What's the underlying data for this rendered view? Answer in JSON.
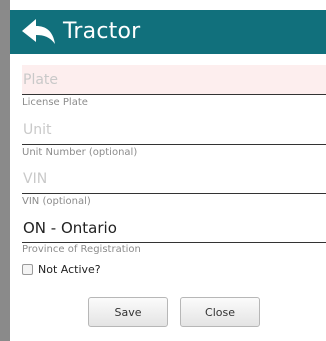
{
  "header": {
    "title": "Tractor",
    "back_icon": "back-arrow-icon",
    "background_color": "#11707c"
  },
  "form": {
    "plate": {
      "placeholder": "Plate",
      "value": "",
      "label": "License Plate",
      "error_background": "#fdeeee"
    },
    "unit": {
      "placeholder": "Unit",
      "value": "",
      "label": "Unit Number (optional)"
    },
    "vin": {
      "placeholder": "VIN",
      "value": "",
      "label": "VIN (optional)"
    },
    "province": {
      "value": "ON - Ontario",
      "label": "Province of Registration"
    },
    "not_active": {
      "label": "Not Active?",
      "checked": false
    }
  },
  "buttons": {
    "save_label": "Save",
    "close_label": "Close"
  }
}
